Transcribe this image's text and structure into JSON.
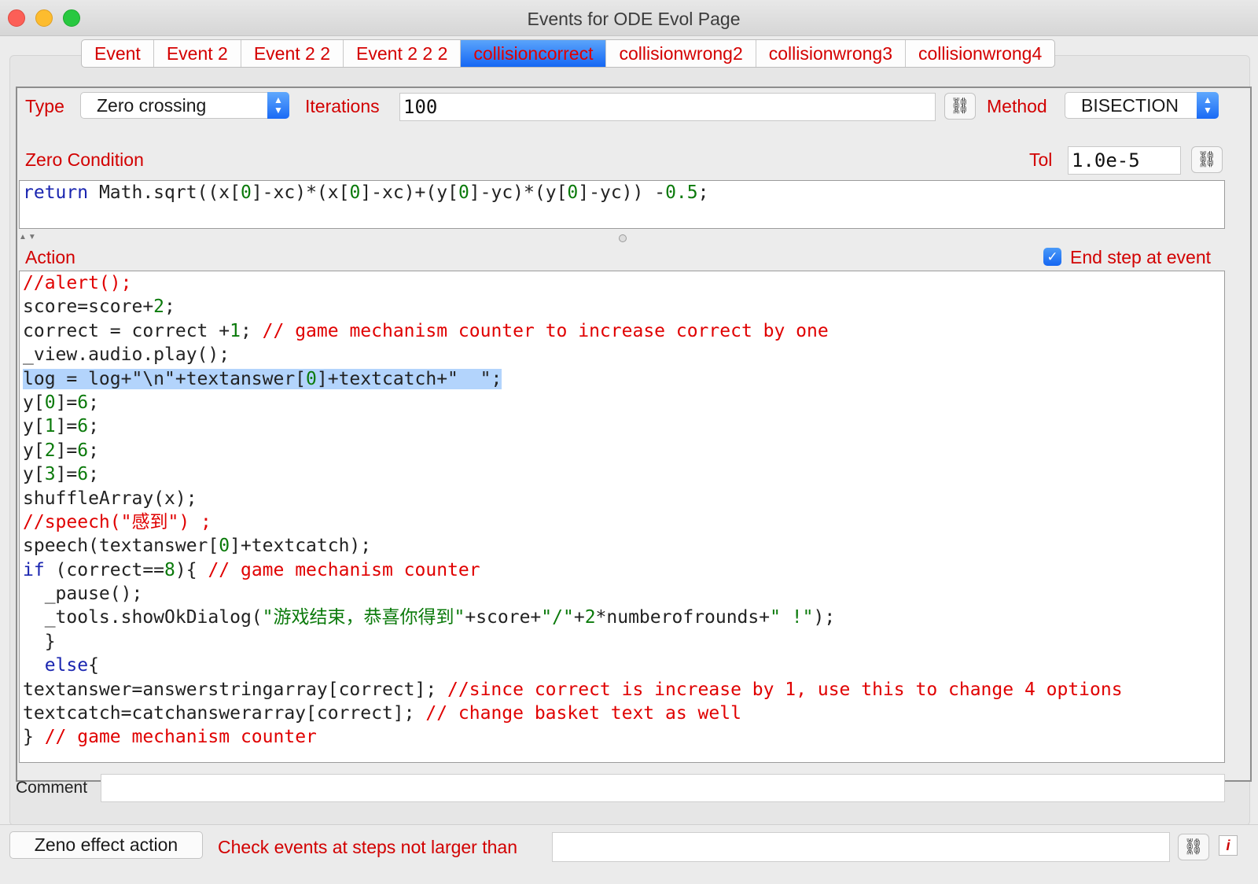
{
  "window": {
    "title": "Events for ODE Evol Page"
  },
  "tabs": [
    {
      "label": "Event",
      "active": false
    },
    {
      "label": "Event 2",
      "active": false
    },
    {
      "label": "Event 2 2",
      "active": false
    },
    {
      "label": "Event 2 2 2",
      "active": false
    },
    {
      "label": "collisioncorrect",
      "active": true
    },
    {
      "label": "collisionwrong2",
      "active": false
    },
    {
      "label": "collisionwrong3",
      "active": false
    },
    {
      "label": "collisionwrong4",
      "active": false
    }
  ],
  "settings": {
    "type_label": "Type",
    "type_value": "Zero crossing",
    "iterations_label": "Iterations",
    "iterations_value": "100",
    "method_label": "Method",
    "method_value": "BISECTION"
  },
  "zero_condition": {
    "label": "Zero Condition",
    "tol_label": "Tol",
    "tol_value": "1.0e-5",
    "code": "return Math.sqrt((x[0]-xc)*(x[0]-xc)+(y[0]-yc)*(y[0]-yc)) -0.5;"
  },
  "action": {
    "label": "Action",
    "end_step_label": "End step at event",
    "end_step_checked": true,
    "code_lines": [
      "//alert();",
      "score=score+2;",
      "correct = correct +1; // game mechanism counter to increase correct by one",
      "_view.audio.play();",
      "log = log+\"\\n\"+textanswer[0]+textcatch+\"  \";",
      "y[0]=6;",
      "y[1]=6;",
      "y[2]=6;",
      "y[3]=6;",
      "shuffleArray(x);",
      "//speech(\"感到\") ;",
      "speech(textanswer[0]+textcatch);",
      "if (correct==8){ // game mechanism counter",
      "  _pause();",
      "  _tools.showOkDialog(\"游戏结束，恭喜你得到\"+score+\"/\"+2*numberofrounds+\" !\");",
      "  }",
      "  else{",
      "textanswer=answerstringarray[correct]; //since correct is increase by 1, use this to change 4 options",
      "textcatch=catchanswerarray[correct]; // change basket text as well",
      "} // game mechanism counter"
    ],
    "selected_line": 4
  },
  "comment": {
    "label": "Comment",
    "value": ""
  },
  "footer": {
    "zeno_button": "Zeno effect action",
    "check_label": "Check events at steps not larger than",
    "check_value": ""
  },
  "icons": {
    "link": "link-icon",
    "info": "info-icon",
    "accent": "#1567f4",
    "label_red": "#d20000"
  }
}
